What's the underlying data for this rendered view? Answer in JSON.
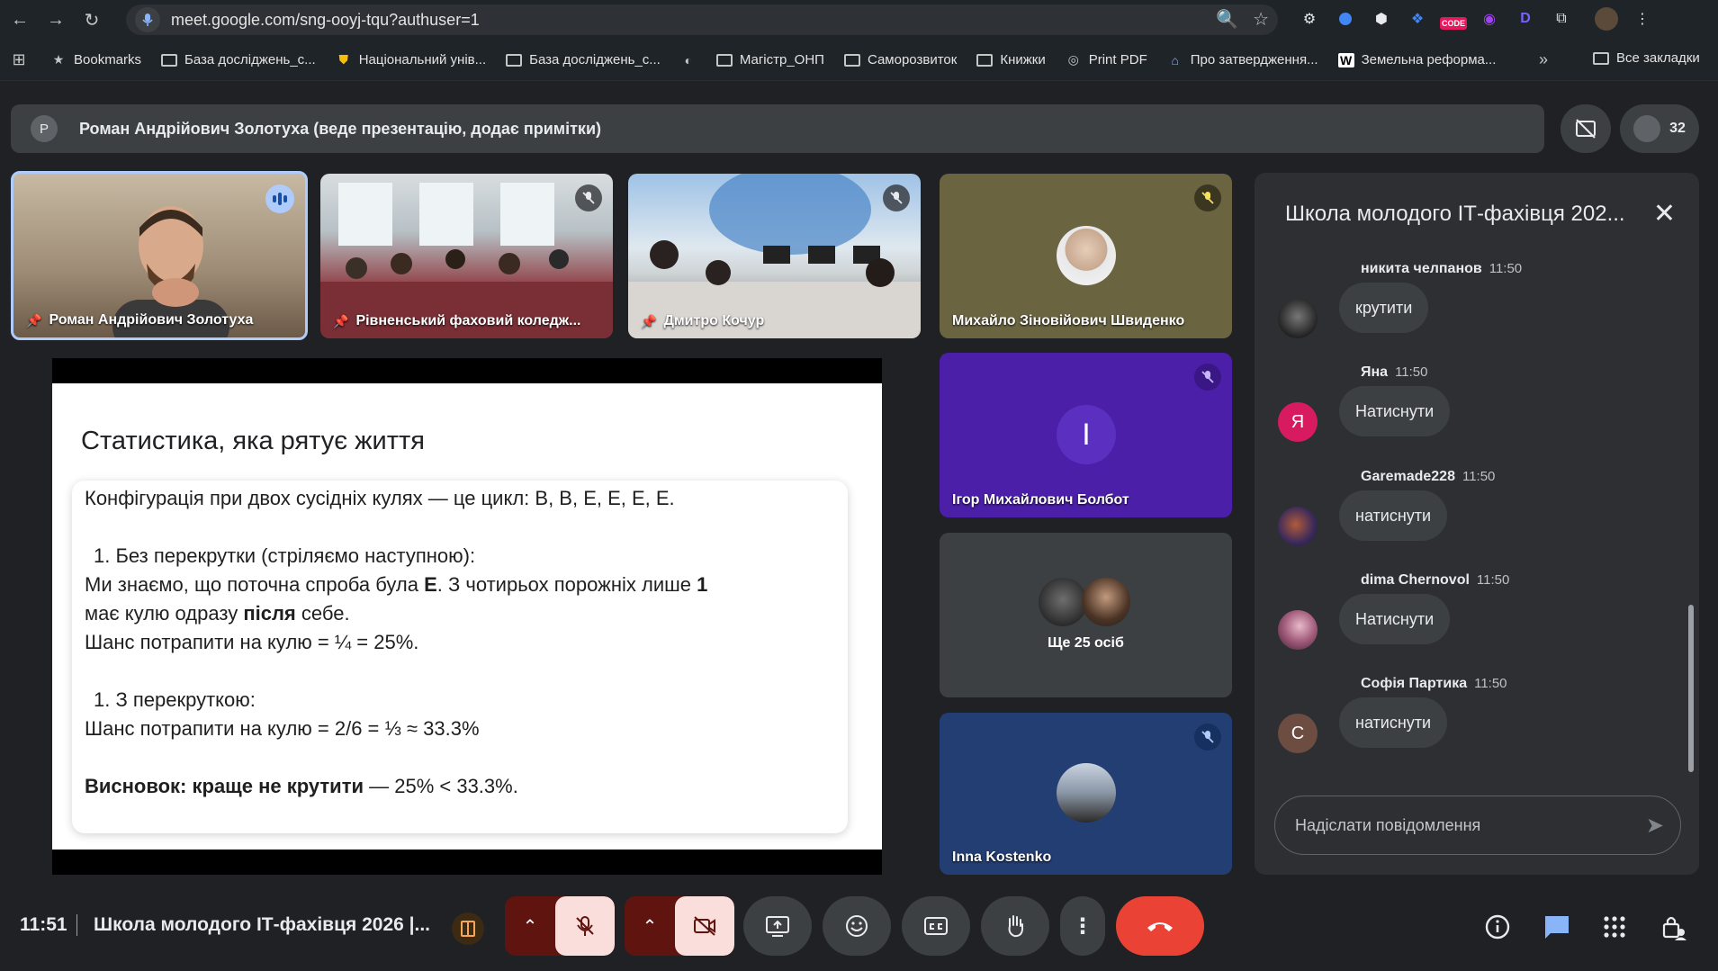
{
  "browser": {
    "url": "meet.google.com/sng-ooyj-tqu?authuser=1",
    "ext_code_label": "CODE",
    "bookmarks": [
      {
        "label": "Bookmarks",
        "icon": "star-icon"
      },
      {
        "label": "База досліджень_с...",
        "icon": "folder-icon"
      },
      {
        "label": "Національний унів...",
        "icon": "shield-icon"
      },
      {
        "label": "База досліджень_с...",
        "icon": "folder-icon"
      },
      {
        "label": "Магістр_ОНП",
        "icon": "folder-icon"
      },
      {
        "label": "Саморозвиток",
        "icon": "folder-icon"
      },
      {
        "label": "Книжки",
        "icon": "folder-icon"
      },
      {
        "label": "Print PDF",
        "icon": "globe-icon"
      },
      {
        "label": "Про затвердження...",
        "icon": "building-icon"
      },
      {
        "label": "Земельна реформа...",
        "icon": "w-icon"
      }
    ],
    "all_bookmarks": "Все закладки"
  },
  "presenter": {
    "avatar_letter": "Р",
    "text": "Роман Андрійович Золотуха (веде презентацію, додає примітки)"
  },
  "participants_count": "32",
  "tiles": {
    "t1_name": "Роман Андрійович Золотуха",
    "t2_name": "Рівненський фаховий коледж...",
    "t3_name": "Дмитро Кочур",
    "t4_name": "Михайло Зіновійович Швиденко",
    "t5_name": "Ігор Михайлович Болбот",
    "t5_letter": "І",
    "t6_name": "Ще 25 осіб",
    "t7_name": "Inna Kostenko"
  },
  "slide": {
    "title": "Статистика, яка рятує життя",
    "line1": "Конфігурація при двох сусідніх кулях — це цикл: В, В, Е, Е, Е, Е.",
    "item1": "1.    Без перекрутки (стріляємо наступною):",
    "l2a": "Ми знаємо, що поточна спроба була ",
    "l2b": "Е",
    "l2c": ". З чотирьох порожніх лише ",
    "l2d": "1",
    "l3a": "має кулю одразу ",
    "l3b": "після",
    "l3c": " себе.",
    "l4": "Шанс потрапити на кулю = ¼ = 25%.",
    "item2": "1.    З перекруткою:",
    "l5": "Шанс потрапити на кулю = 2/6 = ⅓ ≈ 33.3%",
    "concl_b": "Висновок: краще не крутити",
    "concl_r": " — 25% < 33.3%."
  },
  "chat": {
    "title": "Школа молодого ІТ-фахівця 202...",
    "messages": [
      {
        "author": "никита челпанов",
        "time": "11:50",
        "text": "крутити",
        "avatar": ""
      },
      {
        "author": "Яна",
        "time": "11:50",
        "text": "Натиснути",
        "avatar": "Я"
      },
      {
        "author": "Garemade228",
        "time": "11:50",
        "text": "натиснути",
        "avatar": ""
      },
      {
        "author": "dima Chernovol",
        "time": "11:50",
        "text": "Натиснути",
        "avatar": ""
      },
      {
        "author": "Софія Партика",
        "time": "11:50",
        "text": "натиснути",
        "avatar": "С"
      }
    ],
    "input_placeholder": "Надіслати повідомлення"
  },
  "bottom": {
    "time": "11:51",
    "meeting_name": "Школа молодого ІТ-фахівця 2026 |..."
  },
  "colors": {
    "hangup": "#ea4335",
    "muted_bg": "#f9dedc",
    "accent_blue": "#8ab4f8"
  }
}
